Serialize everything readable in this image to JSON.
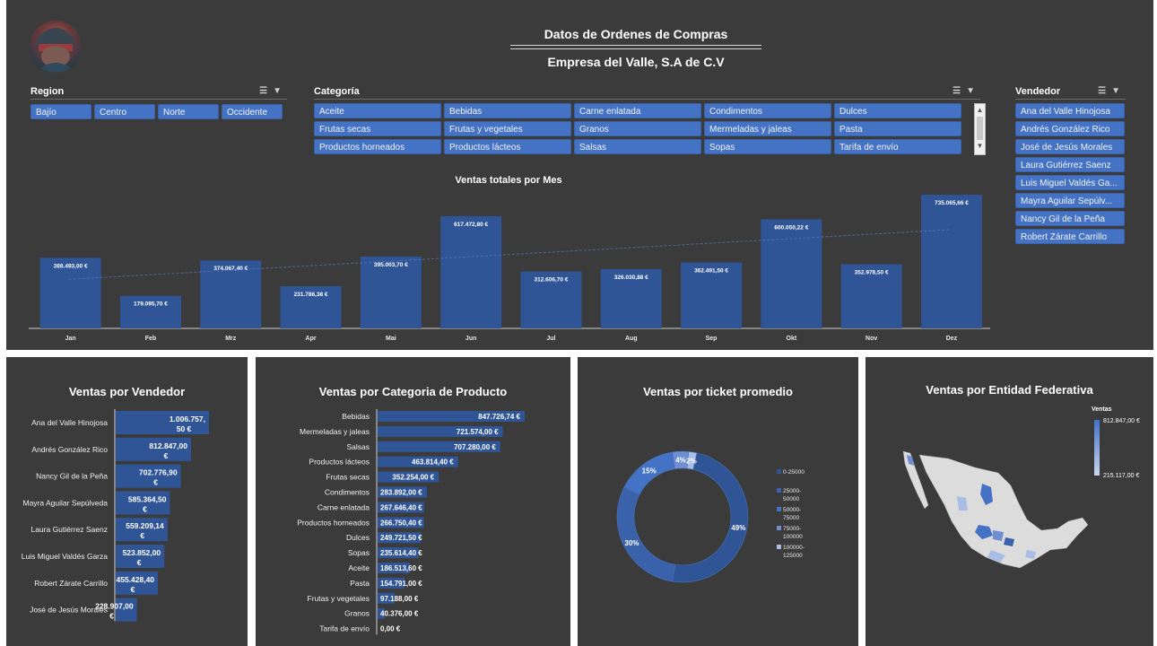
{
  "header": {
    "title": "Datos de Ordenes de Compras",
    "subtitle": "Empresa del Valle, S.A de C.V"
  },
  "slicers": {
    "region": {
      "label": "Region",
      "items": [
        "Bajío",
        "Centro",
        "Norte",
        "Occidente"
      ]
    },
    "categoria": {
      "label": "Categoría",
      "items": [
        "Aceite",
        "Bebidas",
        "Carne enlatada",
        "Condimentos",
        "Dulces",
        "Frutas secas",
        "Frutas y vegetales",
        "Granos",
        "Mermeladas y jaleas",
        "Pasta",
        "Productos horneados",
        "Productos lácteos",
        "Salsas",
        "Sopas",
        "Tarifa de envío"
      ]
    },
    "vendedor": {
      "label": "Vendedor",
      "items": [
        "Ana del Valle Hinojosa",
        "Andrés González Rico",
        "José de Jesús Morales",
        "Laura Gutiérrez Saenz",
        "Luis Miguel Valdés Ga...",
        "Mayra Aguilar Sepúlv...",
        "Nancy Gil de la Peña",
        "Robert Zárate Carrillo"
      ]
    },
    "icons": [
      "multi-select-icon",
      "clear-filter-icon"
    ]
  },
  "colors": {
    "panel_bg": "#3b3b3b",
    "bar": "#2f5597",
    "chip": "#4472c4",
    "donut": [
      "#2f5597",
      "#3a62ab",
      "#4472c4",
      "#6f8fd2",
      "#a9bde6"
    ]
  },
  "chart_data": [
    {
      "type": "bar",
      "title": "Ventas totales por Mes",
      "categories": [
        "Jan",
        "Feb",
        "Mrz",
        "Apr",
        "Mai",
        "Jun",
        "Jul",
        "Aug",
        "Sep",
        "Okt",
        "Nov",
        "Dez"
      ],
      "values": [
        388493.0,
        179095.7,
        374067.4,
        231786.38,
        395003.7,
        617472.8,
        312606.7,
        326030.88,
        362491.5,
        600050.22,
        352978.5,
        735065.66
      ],
      "data_labels": [
        "388.493,00 €",
        "179.095,70 €",
        "374.067,40 €",
        "231.786,38 €",
        "395.003,70 €",
        "617.472,80 €",
        "312.606,70 €",
        "326.030,88 €",
        "362.491,50 €",
        "600.050,22 €",
        "352.978,50 €",
        "735.065,66 €"
      ],
      "trendline": true,
      "ylim": [
        0,
        760000
      ]
    },
    {
      "type": "bar",
      "orientation": "horizontal",
      "title": "Ventas por Vendedor",
      "categories": [
        "Ana del Valle Hinojosa",
        "Andrés González Rico",
        "Nancy Gil de la Peña",
        "Mayra Aguilar Sepúlveda",
        "Laura Gutiérrez Saenz",
        "Luis Miguel Valdés Garza",
        "Robert Zárate Carrillo",
        "José de Jesús Morales"
      ],
      "values": [
        1006757.5,
        812847.0,
        702776.9,
        585364.5,
        559209.14,
        523852.0,
        455428.4,
        228907.0
      ],
      "data_labels": [
        [
          "1.006.757,",
          "50 €"
        ],
        [
          "812.847,00",
          "€"
        ],
        [
          "702.776,90",
          "€"
        ],
        [
          "585.364,50",
          "€"
        ],
        [
          "559.209,14",
          "€"
        ],
        [
          "523.852,00",
          "€"
        ],
        [
          "455.428,40",
          "€"
        ],
        [
          "228.907,00",
          "€"
        ]
      ]
    },
    {
      "type": "bar",
      "orientation": "horizontal",
      "title": "Ventas por Categoria de Producto",
      "categories": [
        "Bebidas",
        "Mermeladas y jaleas",
        "Salsas",
        "Productos lácteos",
        "Frutas secas",
        "Condimentos",
        "Carne enlatada",
        "Productos horneados",
        "Dulces",
        "Sopas",
        "Aceite",
        "Pasta",
        "Frutas y vegetales",
        "Granos",
        "Tarifa de envío"
      ],
      "values": [
        847726.74,
        721574.0,
        707280.0,
        463814.4,
        352254.0,
        283892.0,
        267646.4,
        266750.4,
        249721.5,
        235614.4,
        186513.6,
        154791.0,
        97188.0,
        40376.0,
        0.0
      ],
      "data_labels": [
        "847.726,74 €",
        "721.574,00 €",
        "707.280,00 €",
        "463.814,40 €",
        "352.254,00 €",
        "283.892,00 €",
        "267.646,40 €",
        "266.750,40 €",
        "249.721,50 €",
        "235.614,40 €",
        "186.513,60 €",
        "154.791,00 €",
        "97.188,00 €",
        "40.376,00 €",
        "0,00 €"
      ]
    },
    {
      "type": "pie",
      "donut": true,
      "title": "Ventas por ticket promedio",
      "series": [
        {
          "name": "0-25000",
          "value": 49,
          "label": "49%"
        },
        {
          "name": "25000-50000",
          "value": 30,
          "label": "30%"
        },
        {
          "name": "50000-75000",
          "value": 15,
          "label": "15%"
        },
        {
          "name": "75000-100000",
          "value": 4,
          "label": "4%"
        },
        {
          "name": "100000-125000",
          "value": 2,
          "label": "2%"
        }
      ],
      "legend": "right",
      "legend_labels": [
        [
          "0-25000"
        ],
        [
          "25000-",
          "50000"
        ],
        [
          "50000-",
          "75000"
        ],
        [
          "75000-",
          "100000"
        ],
        [
          "100000-",
          "125000"
        ]
      ]
    },
    {
      "type": "heatmap",
      "title": "Ventas por Entidad Federativa",
      "legend_title": "Ventas",
      "range": [
        215117.0,
        812847.0
      ],
      "range_labels": [
        "812.847,00 €",
        "215.117,00 €"
      ]
    }
  ]
}
